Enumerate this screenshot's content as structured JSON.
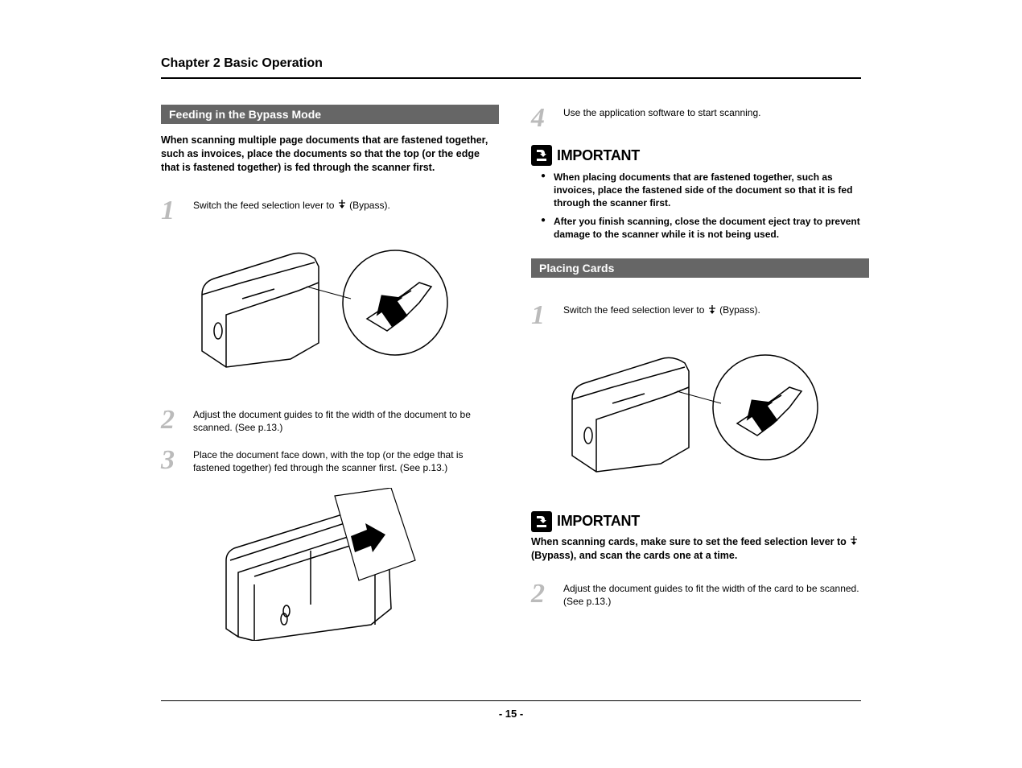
{
  "chapter": "Chapter 2 Basic Operation",
  "left": {
    "section_heading": "Feeding in the Bypass Mode",
    "intro": "When scanning multiple page documents that are fastened together, such as invoices, place the documents so that the top (or the edge that is fastened together) is fed through the scanner first.",
    "step1_num": "1",
    "step1_text_a": "Switch the feed selection lever to ",
    "step1_text_b": " (Bypass).",
    "step2_num": "2",
    "step2_text": "Adjust the document guides to fit the width of the document to be scanned. (See p.13.)",
    "step3_num": "3",
    "step3_text": "Place the document face down, with the top (or the edge that is fastened together) fed through the scanner first. (See p.13.)"
  },
  "right": {
    "step4_num": "4",
    "step4_text": "Use the application software to start scanning.",
    "important1_label": "IMPORTANT",
    "important1_items": [
      "When placing documents that are fastened together, such as invoices,  place the fastened side of the document so that it is fed through the scanner first.",
      "After you finish scanning, close the document eject tray to prevent damage to the scanner while it is not being used."
    ],
    "section_heading": "Placing Cards",
    "step1_num": "1",
    "step1_text_a": "Switch the feed selection lever to ",
    "step1_text_b": " (Bypass).",
    "important2_label": "IMPORTANT",
    "important2_text_a": "When scanning cards, make sure to set the feed selection lever to ",
    "important2_text_b": " (Bypass), and scan the cards one at a time.",
    "step2_num": "2",
    "step2_text": "Adjust the document guides to fit the width of the card to be scanned. (See p.13.)"
  },
  "page_number": "- 15 -"
}
